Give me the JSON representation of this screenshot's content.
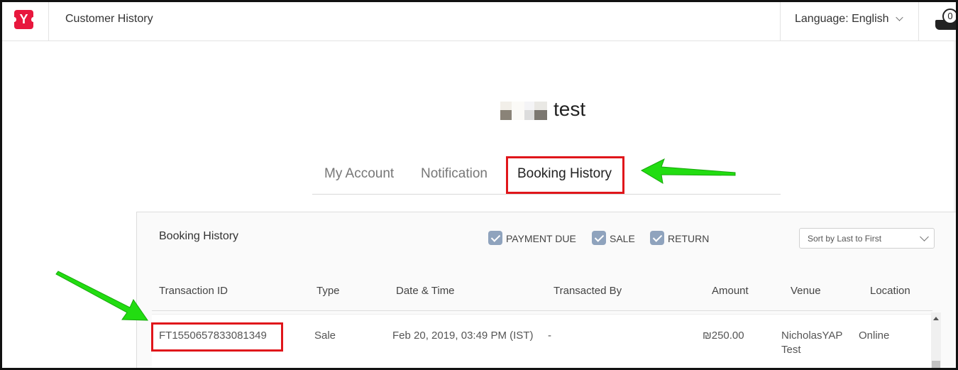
{
  "header": {
    "page_title": "Customer History",
    "language_label": "Language: English",
    "cart_count": "0",
    "brand_color": "#e8173d",
    "logo_letter": "Y"
  },
  "profile": {
    "name": "test"
  },
  "tabs": [
    {
      "label": "My Account",
      "active": false
    },
    {
      "label": "Notification",
      "active": false
    },
    {
      "label": "Booking History",
      "active": true
    }
  ],
  "booking_history": {
    "title": "Booking History",
    "filters": [
      {
        "label": "PAYMENT DUE",
        "checked": true
      },
      {
        "label": "SALE",
        "checked": true
      },
      {
        "label": "RETURN",
        "checked": true
      }
    ],
    "sort": {
      "selected": "Sort by Last to First"
    },
    "columns": [
      "Transaction ID",
      "Type",
      "Date & Time",
      "Transacted By",
      "Amount",
      "Venue",
      "Location"
    ],
    "rows": [
      {
        "transaction_id": "FT1550657833081349",
        "type": "Sale",
        "date_time": "Feb 20, 2019, 03:49 PM (IST)",
        "transacted_by": "-",
        "amount": "₪250.00",
        "venue_line1": "NicholasYAP",
        "venue_line2": "Test",
        "location": "Online"
      }
    ]
  },
  "annotations": {
    "highlight_color": "#e0161b",
    "arrow_color": "#22dd11"
  }
}
